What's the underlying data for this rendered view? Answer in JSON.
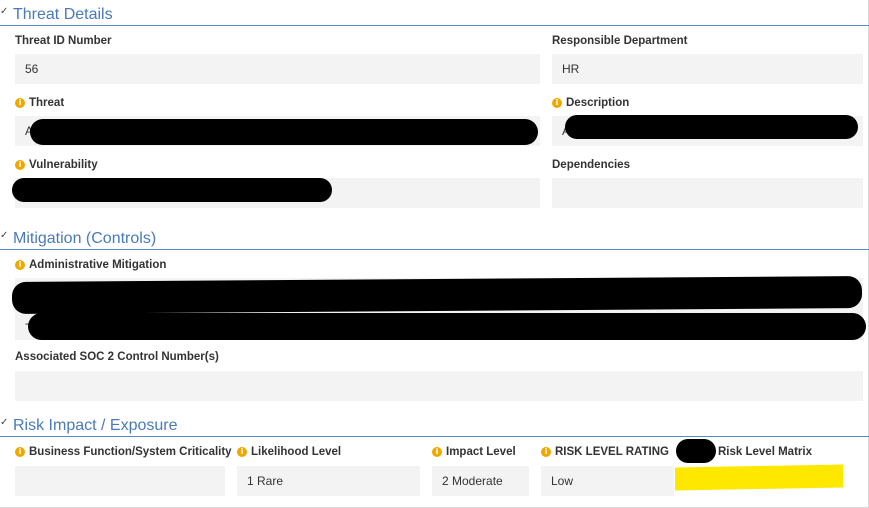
{
  "sections": {
    "threat": {
      "title": "Threat Details"
    },
    "mitigation": {
      "title": "Mitigation (Controls)"
    },
    "risk": {
      "title": "Risk Impact / Exposure"
    }
  },
  "threat_details": {
    "threat_id": {
      "label": "Threat ID Number",
      "value": "56"
    },
    "department": {
      "label": "Responsible Department",
      "value": "HR"
    },
    "threat": {
      "label": "Threat",
      "value": "A"
    },
    "description": {
      "label": "Description",
      "value": "A"
    },
    "vulnerability": {
      "label": "Vulnerability",
      "value": ""
    },
    "dependencies": {
      "label": "Dependencies",
      "value": ""
    }
  },
  "mitigation": {
    "admin": {
      "label": "Administrative Mitigation",
      "value": "-"
    },
    "soc2": {
      "label": "Associated SOC 2 Control Number(s)",
      "value": ""
    }
  },
  "risk": {
    "criticality": {
      "label": "Business Function/System Criticality",
      "value": ""
    },
    "likelihood": {
      "label": "Likelihood Level",
      "value": "1 Rare"
    },
    "impact": {
      "label": "Impact Level",
      "value": "2 Moderate"
    },
    "rating": {
      "label": "RISK LEVEL RATING",
      "value": "Low"
    },
    "matrix": {
      "label": "Risk Level Matrix"
    }
  },
  "colors": {
    "section_title": "#4a7ab8",
    "info_icon": "#f0a800",
    "field_bg": "#f3f3f3",
    "matrix_highlight": "#ffe800"
  },
  "icons": {
    "info": "info-icon",
    "collapse": "chevron-down-icon"
  }
}
